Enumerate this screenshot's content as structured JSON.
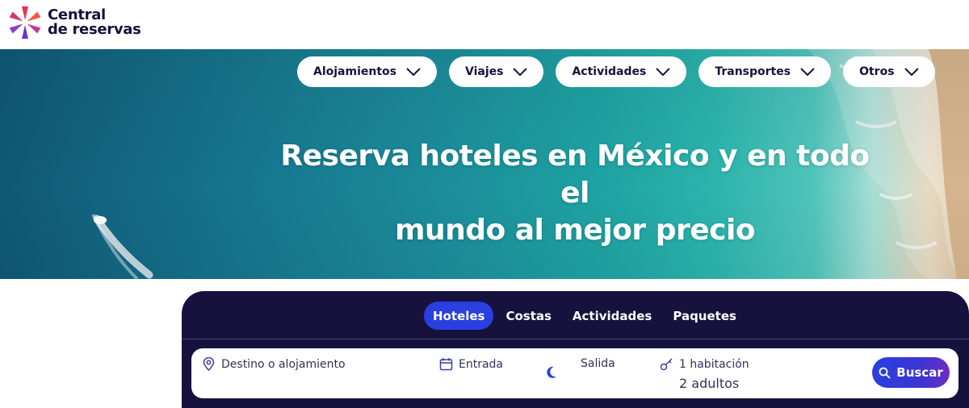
{
  "brand": {
    "line1": "Central",
    "line2": "de reservas"
  },
  "nav": [
    {
      "label": "Alojamientos"
    },
    {
      "label": "Viajes"
    },
    {
      "label": "Actividades"
    },
    {
      "label": "Transportes"
    },
    {
      "label": "Otros"
    }
  ],
  "hero": {
    "line1": "Reserva hoteles en México y en todo el",
    "line2": "mundo al mejor precio"
  },
  "tabs": [
    {
      "label": "Hoteles",
      "active": true
    },
    {
      "label": "Costas",
      "active": false
    },
    {
      "label": "Actividades",
      "active": false
    },
    {
      "label": "Paquetes",
      "active": false
    }
  ],
  "search": {
    "destination_placeholder": "Destino o alojamiento",
    "checkin_label": "Entrada",
    "checkout_label": "Salida",
    "rooms_label": "1 habitación",
    "guests_value": "2 adultos",
    "button_label": "Buscar"
  },
  "colors": {
    "primary": "#16123d",
    "accent": "#2a3fe0",
    "button_end": "#6a2cc4"
  }
}
